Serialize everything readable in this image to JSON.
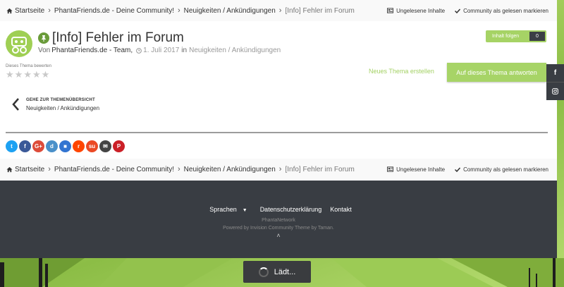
{
  "breadcrumb": {
    "items": [
      "Startseite",
      "PhantaFriends.de - Deine Community!",
      "Neuigkeiten / Ankündigungen"
    ],
    "current": "[Info] Fehler im Forum"
  },
  "crumb_actions": {
    "unread": "Ungelesene Inhalte",
    "mark_read": "Community als gelesen markieren"
  },
  "topic": {
    "title": "[Info] Fehler im Forum",
    "by": "Von",
    "author": "PhantaFriends.de - Team,",
    "date": "1. Juli 2017",
    "in": "in",
    "forum": "Neuigkeiten / Ankündigungen"
  },
  "follow": {
    "label": "Inhalt folgen",
    "count": "0"
  },
  "rating": {
    "label": "Dieses Thema bewerten",
    "stars": 0,
    "max": 5
  },
  "actions": {
    "new_topic": "Neues Thema erstellen",
    "reply": "Auf dieses Thema antworten"
  },
  "back": {
    "label": "GEHE ZUR THEMENÜBERSICHT",
    "forum": "Neuigkeiten / Ankündigungen"
  },
  "share": [
    {
      "name": "twitter",
      "glyph": "t",
      "color": "#1da1f2"
    },
    {
      "name": "facebook",
      "glyph": "f",
      "color": "#3b5998"
    },
    {
      "name": "google-plus",
      "glyph": "G+",
      "color": "#dd4b39"
    },
    {
      "name": "digg",
      "glyph": "d",
      "color": "#4a90c9"
    },
    {
      "name": "delicious",
      "glyph": "■",
      "color": "#3274d1"
    },
    {
      "name": "reddit",
      "glyph": "r",
      "color": "#ff4500"
    },
    {
      "name": "stumbleupon",
      "glyph": "su",
      "color": "#eb4924"
    },
    {
      "name": "email",
      "glyph": "✉",
      "color": "#444444"
    },
    {
      "name": "pinterest",
      "glyph": "P",
      "color": "#cb2027"
    }
  ],
  "footer": {
    "language": "Sprachen",
    "privacy": "Datenschutzerklärung",
    "contact": "Kontakt",
    "network": "PhantaNetwork",
    "powered": "Powered by Invision Community Theme by Taman."
  },
  "loading": "Lädt...",
  "colors": {
    "accent": "#a7d467",
    "footer_bg": "#393d43",
    "pin": "#6a9b3a"
  }
}
